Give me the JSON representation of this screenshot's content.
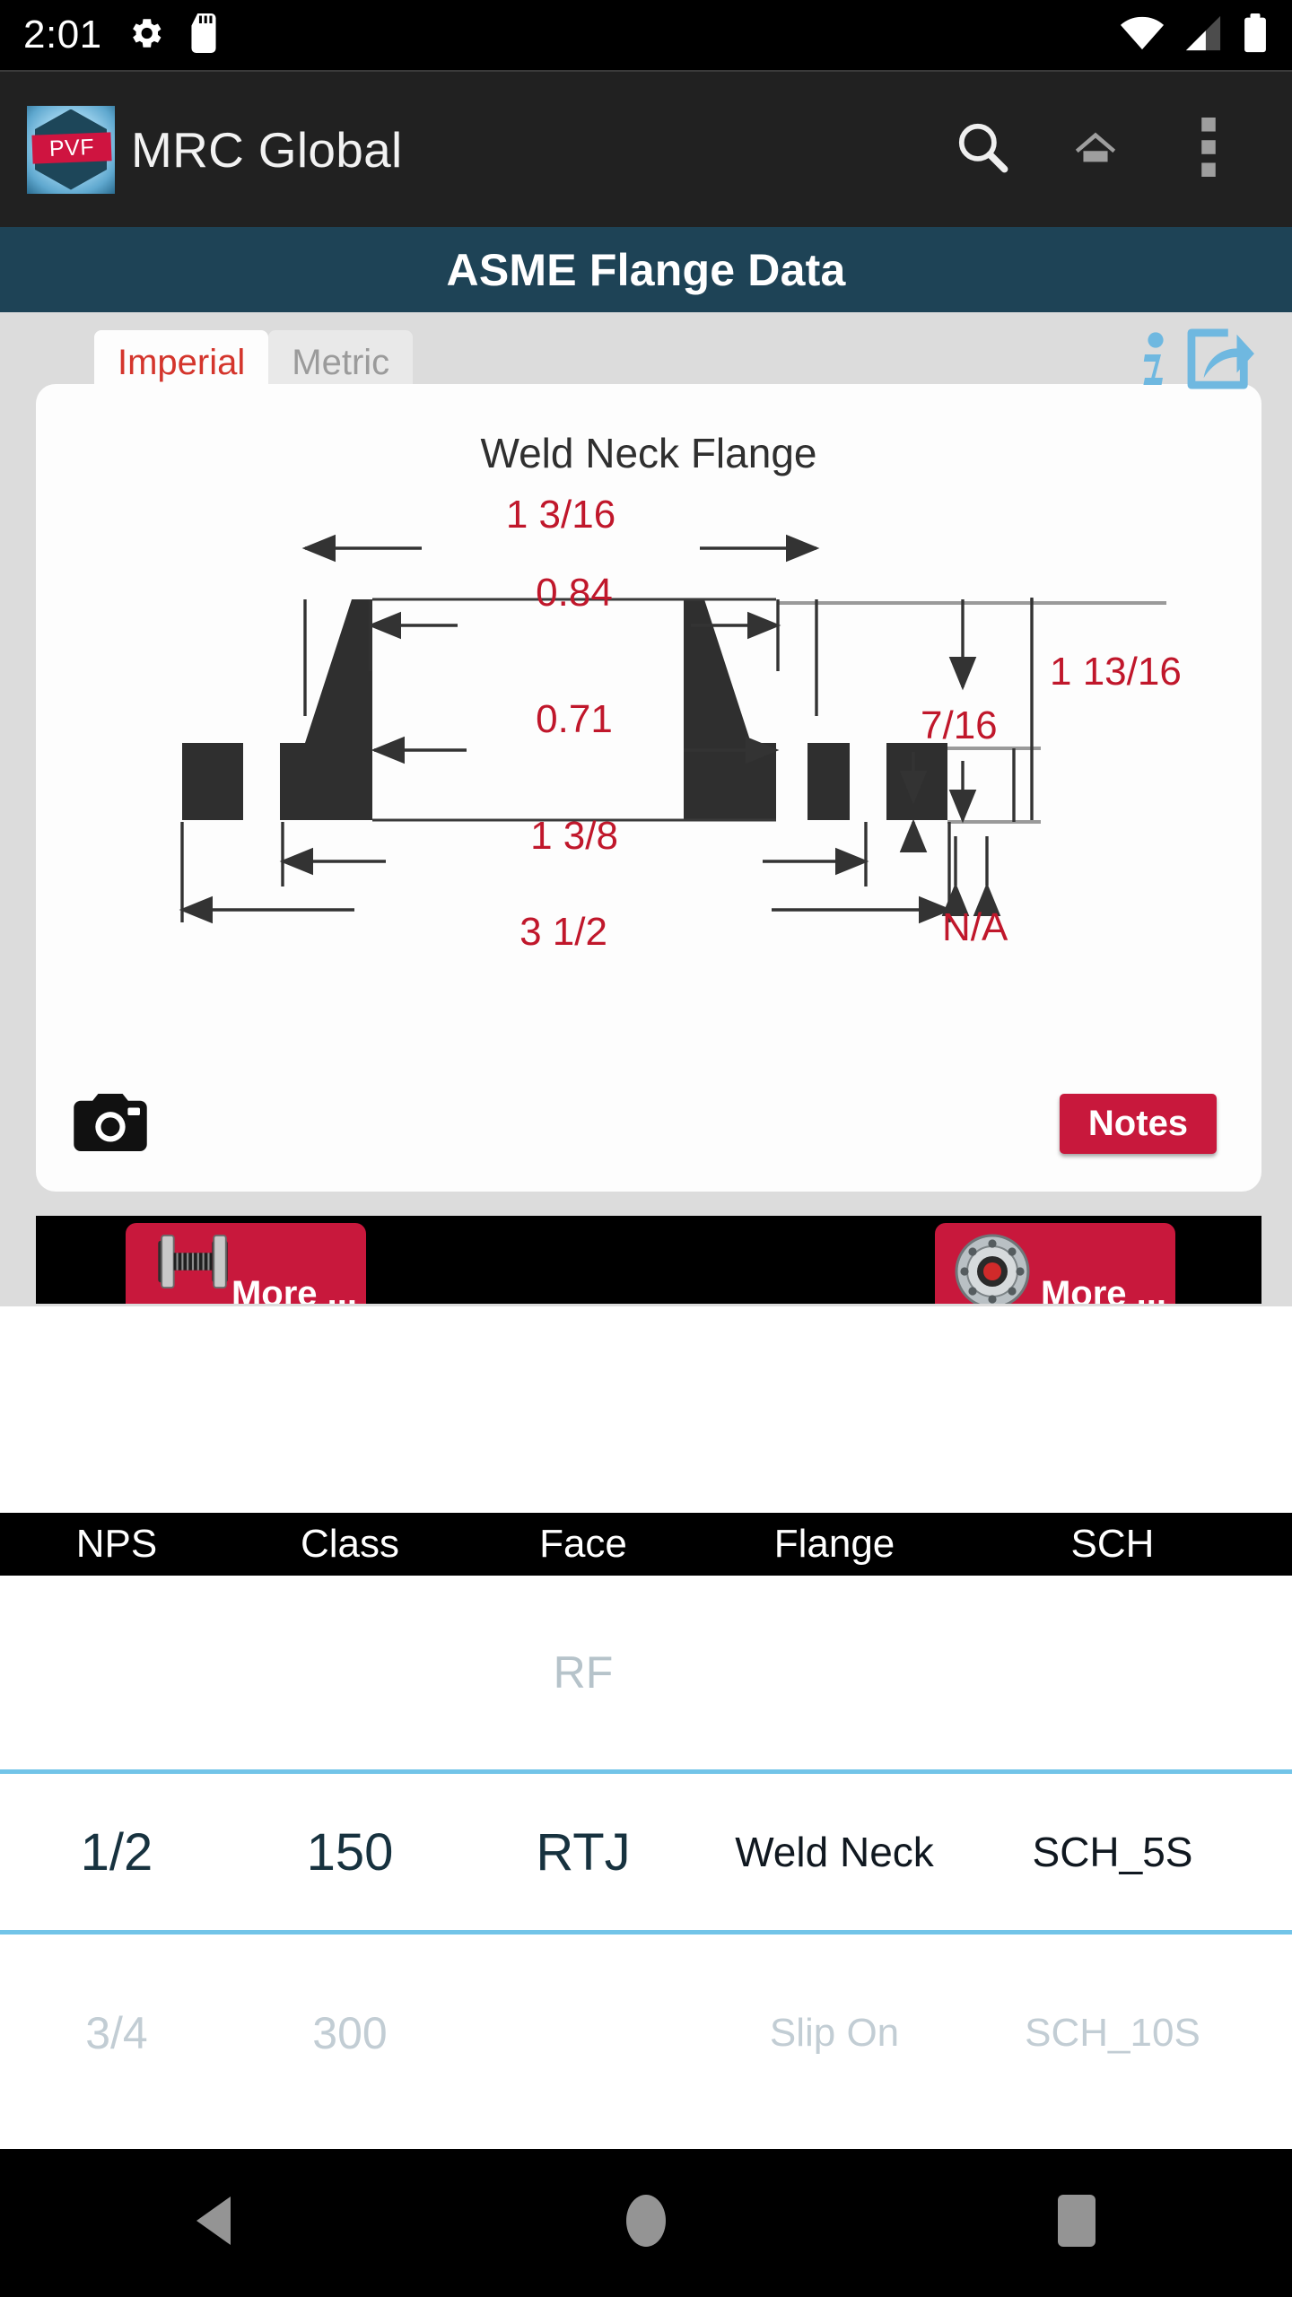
{
  "status_bar": {
    "time": "2:01",
    "left_icons": [
      "settings-gear-icon",
      "sd-card-icon"
    ],
    "right_icons": [
      "wifi-icon",
      "cell-signal-icon",
      "battery-icon"
    ]
  },
  "action_bar": {
    "logo_text": "PVF",
    "app_title": "MRC Global",
    "actions": [
      "search-icon",
      "home-icon",
      "overflow-menu-icon"
    ]
  },
  "page_title": "ASME Flange Data",
  "units_tabs": [
    {
      "label": "Imperial",
      "active": true
    },
    {
      "label": "Metric",
      "active": false
    }
  ],
  "top_icons": [
    "info-icon",
    "share-icon"
  ],
  "diagram": {
    "title": "Weld Neck Flange",
    "dimensions": {
      "hub_top": "1 3/16",
      "bore_top": "0.84",
      "bore": "0.71",
      "hub_base": "1 3/8",
      "outside_diameter": "3 1/2",
      "length_thru_hub": "1 13/16",
      "thickness": "7/16",
      "raised_face": "N/A"
    },
    "camera_icon": "camera-icon",
    "notes_label": "Notes"
  },
  "more_buttons": [
    {
      "label": "More ...",
      "icon": "bolt-stud-icon"
    },
    {
      "label": "More ...",
      "icon": "gasket-flange-icon"
    }
  ],
  "table": {
    "columns": [
      "NPS",
      "Class",
      "Face",
      "Flange",
      "SCH"
    ],
    "rows": [
      {
        "state": "above",
        "NPS": "",
        "Class": "",
        "Face": "RF",
        "Flange": "",
        "SCH": ""
      },
      {
        "state": "selected",
        "NPS": "1/2",
        "Class": "150",
        "Face": "RTJ",
        "Flange": "Weld Neck",
        "SCH": "SCH_5S"
      },
      {
        "state": "below",
        "NPS": "3/4",
        "Class": "300",
        "Face": "",
        "Flange": "Slip On",
        "SCH": "SCH_10S"
      }
    ]
  },
  "nav_bar": [
    "back-icon",
    "home-circle-icon",
    "recents-icon"
  ],
  "colors": {
    "accent_red": "#c8183c",
    "title_bar": "#1e4356",
    "tab_active_text": "#d4352c",
    "selection_line": "#72c4e8",
    "dimension_text": "#c0172b",
    "info_icon": "#6fb8e0"
  }
}
